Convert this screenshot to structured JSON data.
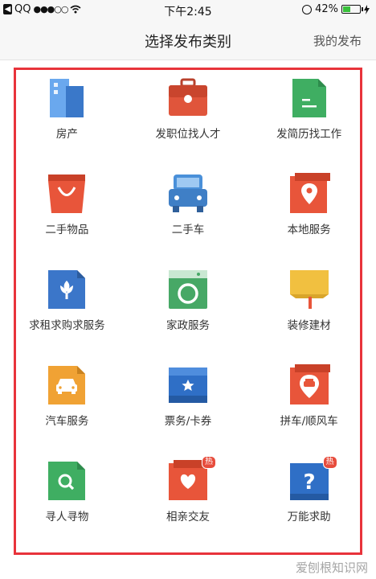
{
  "status_bar": {
    "back_app": "QQ",
    "signal": "●●●○○",
    "time": "下午2:45",
    "battery_percent": "42%"
  },
  "nav": {
    "title": "选择发布类别",
    "right_link": "我的发布"
  },
  "categories": [
    {
      "label": "房产",
      "icon": "building-icon",
      "color": "#4a90d9"
    },
    {
      "label": "发职位找人才",
      "icon": "briefcase-icon",
      "color": "#e0553b"
    },
    {
      "label": "发简历找工作",
      "icon": "resume-document-icon",
      "color": "#3fae62"
    },
    {
      "label": "二手物品",
      "icon": "shopping-bag-icon",
      "color": "#e8553a"
    },
    {
      "label": "二手车",
      "icon": "car-icon",
      "color": "#4a90d9"
    },
    {
      "label": "本地服务",
      "icon": "location-pin-icon",
      "color": "#e8553a"
    },
    {
      "label": "求租求购求服务",
      "icon": "flower-document-icon",
      "color": "#3b76c9"
    },
    {
      "label": "家政服务",
      "icon": "washing-machine-icon",
      "color": "#47a866"
    },
    {
      "label": "装修建材",
      "icon": "paint-roller-icon",
      "color": "#f1c040"
    },
    {
      "label": "汽车服务",
      "icon": "car-document-icon",
      "color": "#f0a234"
    },
    {
      "label": "票务/卡券",
      "icon": "ticket-star-icon",
      "color": "#2f6fc6"
    },
    {
      "label": "拼车/顺风车",
      "icon": "carpool-pin-icon",
      "color": "#e8553a"
    },
    {
      "label": "寻人寻物",
      "icon": "search-document-icon",
      "color": "#3fae62"
    },
    {
      "label": "相亲交友",
      "icon": "heart-chat-icon",
      "color": "#e8553a",
      "badge": "热"
    },
    {
      "label": "万能求助",
      "icon": "question-icon",
      "color": "#2f6fc6",
      "badge": "热"
    }
  ],
  "watermark": "爱刨根知识网"
}
